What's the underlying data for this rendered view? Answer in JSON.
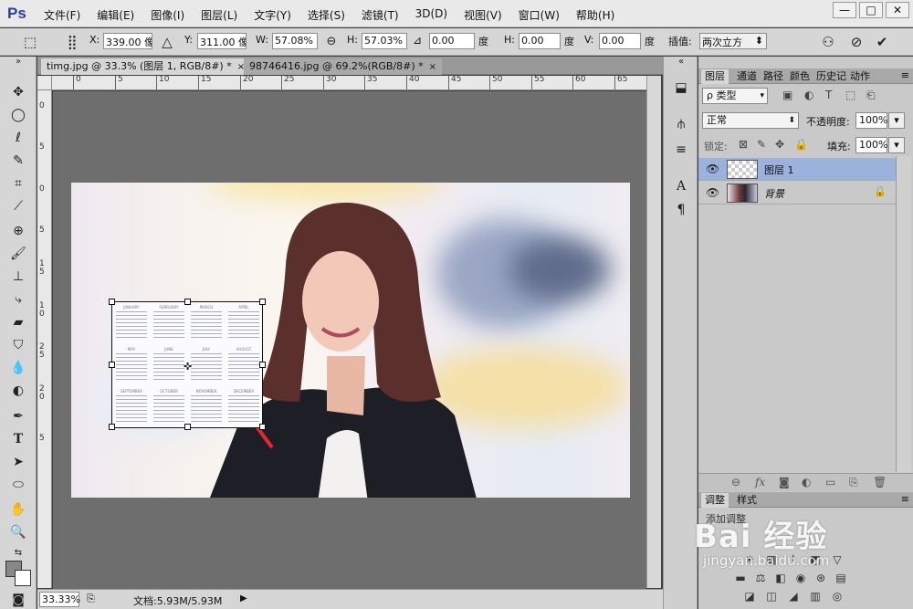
{
  "app": {
    "logo": "Ps"
  },
  "menu": [
    "文件(F)",
    "编辑(E)",
    "图像(I)",
    "图层(L)",
    "文字(Y)",
    "选择(S)",
    "滤镜(T)",
    "3D(D)",
    "视图(V)",
    "窗口(W)",
    "帮助(H)"
  ],
  "window_controls": {
    "minimize": "—",
    "maximize": "□",
    "close": "✕"
  },
  "options": {
    "x_label": "X:",
    "x_value": "339.00 像",
    "y_label": "Y:",
    "y_value": "311.00 像",
    "w_label": "W:",
    "w_value": "57.08%",
    "h_label": "H:",
    "h_value": "57.03%",
    "angle_value": "0.00",
    "angle_unit": "度",
    "hskew_label": "H:",
    "hskew_value": "0.00",
    "hskew_unit": "度",
    "vskew_label": "V:",
    "vskew_value": "0.00",
    "vskew_unit": "度",
    "interp_label": "插值:",
    "interp_value": "两次立方"
  },
  "tabs": [
    {
      "title": "timg.jpg @ 33.3% (图层 1, RGB/8#) *",
      "close": "×"
    },
    {
      "title": "98746416.jpg @ 69.2%(RGB/8#) *",
      "close": "×"
    }
  ],
  "ruler_top": [
    "0",
    "5",
    "10",
    "15",
    "20",
    "25",
    "30",
    "35",
    "40",
    "45",
    "50",
    "55",
    "60",
    "65"
  ],
  "ruler_left": [
    "0",
    "5",
    "0",
    "5",
    "1",
    "5",
    "1",
    "0",
    "2",
    "5",
    "2",
    "0",
    "5"
  ],
  "calendar_months": [
    "JANUARY",
    "FEBRUARY",
    "MARCH",
    "APRIL",
    "MAY",
    "JUNE",
    "JULY",
    "AUGUST",
    "SEPTEMBER",
    "OCTOBER",
    "NOVEMBER",
    "DECEMBER"
  ],
  "status": {
    "zoom": "33.33%",
    "doc": "文档:5.93M/5.93M"
  },
  "layers_panel": {
    "tabs": [
      "图层",
      "通道",
      "路径",
      "颜色",
      "历史记",
      "动作"
    ],
    "filter": "ρ 类型",
    "blend_mode": "正常",
    "opacity_label": "不透明度:",
    "opacity_value": "100%",
    "lock_label": "锁定:",
    "fill_label": "填充:",
    "fill_value": "100%",
    "layers": [
      {
        "name": "图层 1",
        "selected": true
      },
      {
        "name": "背景",
        "locked": true
      }
    ]
  },
  "adjust_panel": {
    "tabs": [
      "调整",
      "样式"
    ],
    "title": "添加调整"
  },
  "watermark": {
    "brand": "Bai 经验",
    "url": "jingyan.baidu.com"
  },
  "colors": {
    "layer_selected": "#9ab2dc",
    "canvas_bg": "#6e6e6e",
    "ui_gray": "#d6d6d6",
    "arrow_red": "#e8272b",
    "ps_blue": "#2c3f9e"
  }
}
